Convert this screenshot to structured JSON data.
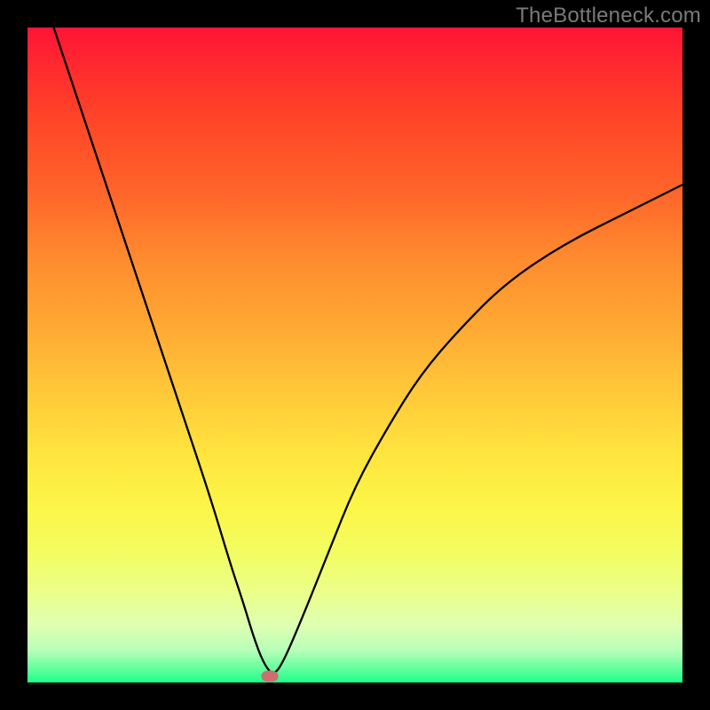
{
  "watermark": "TheBottleneck.com",
  "chart_data": {
    "type": "line",
    "title": "",
    "xlabel": "",
    "ylabel": "",
    "xlim": [
      0,
      100
    ],
    "ylim": [
      0,
      100
    ],
    "grid": false,
    "legend": false,
    "series": [
      {
        "name": "bottleneck-curve",
        "x": [
          4,
          8,
          12,
          16,
          20,
          24,
          28,
          31,
          33,
          34.5,
          36,
          37.5,
          39,
          42,
          46,
          50,
          55,
          60,
          66,
          73,
          82,
          92,
          100
        ],
        "y": [
          100,
          88,
          76,
          64,
          52,
          40,
          28,
          18,
          12,
          7,
          3,
          1,
          3,
          10,
          20,
          30,
          39,
          47,
          54,
          61,
          67,
          72,
          76
        ]
      }
    ],
    "marker": {
      "x": 37,
      "y": 1,
      "color": "#cc6f70"
    },
    "background_gradient": {
      "type": "vertical",
      "stops": [
        {
          "pos": 0,
          "color": "#ff1435"
        },
        {
          "pos": 50,
          "color": "#ffb635"
        },
        {
          "pos": 80,
          "color": "#f3fc60"
        },
        {
          "pos": 100,
          "color": "#1eff8c"
        }
      ]
    }
  }
}
